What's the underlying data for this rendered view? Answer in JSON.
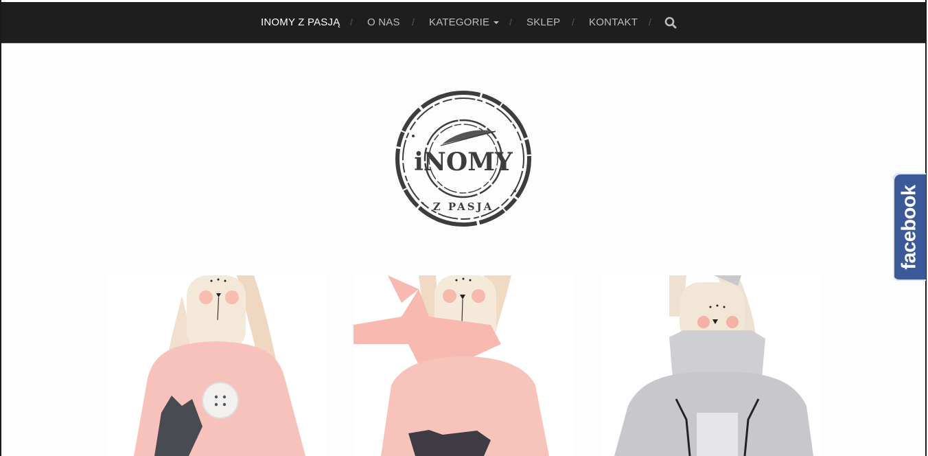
{
  "nav": {
    "items": [
      {
        "label": "INOMY Z PASJĄ",
        "active": true
      },
      {
        "label": "O NAS"
      },
      {
        "label": "KATEGORIE",
        "dropdown": true
      },
      {
        "label": "SKLEP"
      },
      {
        "label": "KONTAKT"
      }
    ],
    "separator": "/",
    "search_icon": "search-icon"
  },
  "logo": {
    "text_main": "iNOMY",
    "text_sub": "Z PASJA"
  },
  "facebook_tab": {
    "label": "facebook"
  },
  "products": [
    {
      "name": "pink-bunny-button"
    },
    {
      "name": "pink-bunny-scarf"
    },
    {
      "name": "grey-bunny-hoodie"
    }
  ],
  "colors": {
    "nav_bg": "#1e1e1e",
    "nav_text": "#bdbdbd",
    "active": "#ffffff",
    "facebook": "#3b5998"
  }
}
